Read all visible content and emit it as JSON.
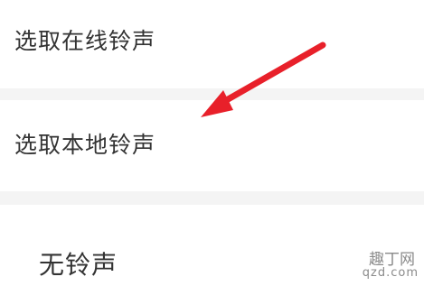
{
  "options": {
    "online_ringtone": "选取在线铃声",
    "local_ringtone": "选取本地铃声",
    "no_ringtone": "无铃声"
  },
  "annotation": {
    "arrow_color": "#e8202a"
  },
  "watermark": {
    "line1": "趣丁网",
    "line2": "qzd.com"
  }
}
